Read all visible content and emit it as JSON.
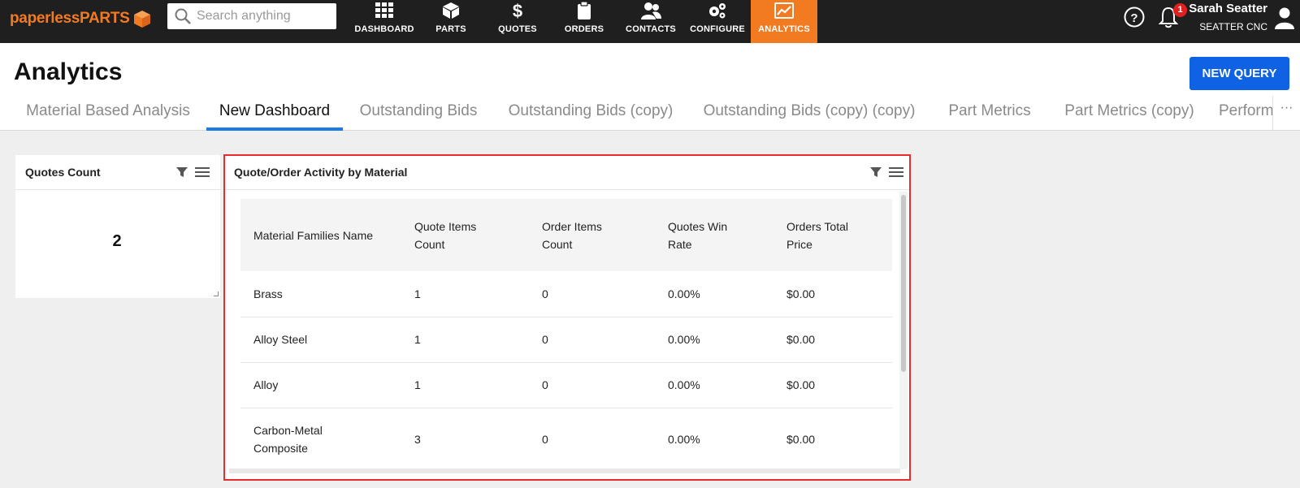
{
  "app": {
    "logo_text": "paperlessPARTS",
    "search_placeholder": "Search anything"
  },
  "nav": [
    {
      "label": "DASHBOARD",
      "icon": "grid-icon"
    },
    {
      "label": "PARTS",
      "icon": "cube-icon"
    },
    {
      "label": "QUOTES",
      "icon": "dollar-icon"
    },
    {
      "label": "ORDERS",
      "icon": "clipboard-icon"
    },
    {
      "label": "CONTACTS",
      "icon": "people-icon"
    },
    {
      "label": "CONFIGURE",
      "icon": "gears-icon"
    },
    {
      "label": "ANALYTICS",
      "icon": "chart-line-icon",
      "active": true
    }
  ],
  "user": {
    "name": "Sarah Seatter",
    "company": "SEATTER CNC",
    "notifications": "1"
  },
  "page": {
    "title": "Analytics",
    "new_query_label": "NEW QUERY",
    "more_label": "···"
  },
  "tabs": [
    {
      "label": "Material Based Analysis"
    },
    {
      "label": "New Dashboard",
      "active": true
    },
    {
      "label": "Outstanding Bids"
    },
    {
      "label": "Outstanding Bids (copy)"
    },
    {
      "label": "Outstanding Bids (copy) (copy)"
    },
    {
      "label": "Part Metrics"
    },
    {
      "label": "Part Metrics (copy)"
    },
    {
      "label": "Performance"
    }
  ],
  "widgets": {
    "quotes_count": {
      "title": "Quotes Count",
      "value": "2"
    },
    "activity": {
      "title": "Quote/Order Activity by Material",
      "columns": [
        "Material Families Name",
        "Quote Items Count",
        "Order Items Count",
        "Quotes Win Rate",
        "Orders Total Price"
      ],
      "rows": [
        [
          "Brass",
          "1",
          "0",
          "0.00%",
          "$0.00"
        ],
        [
          "Alloy Steel",
          "1",
          "0",
          "0.00%",
          "$0.00"
        ],
        [
          "Alloy",
          "1",
          "0",
          "0.00%",
          "$0.00"
        ],
        [
          "Carbon-Metal Composite",
          "3",
          "0",
          "0.00%",
          "$0.00"
        ]
      ]
    }
  },
  "colors": {
    "brand_orange": "#f27b21",
    "nav_bg": "#1f1f1f",
    "primary_blue": "#1062e5",
    "tab_underline": "#1b7ce6",
    "highlight_red": "#e82b2b"
  }
}
